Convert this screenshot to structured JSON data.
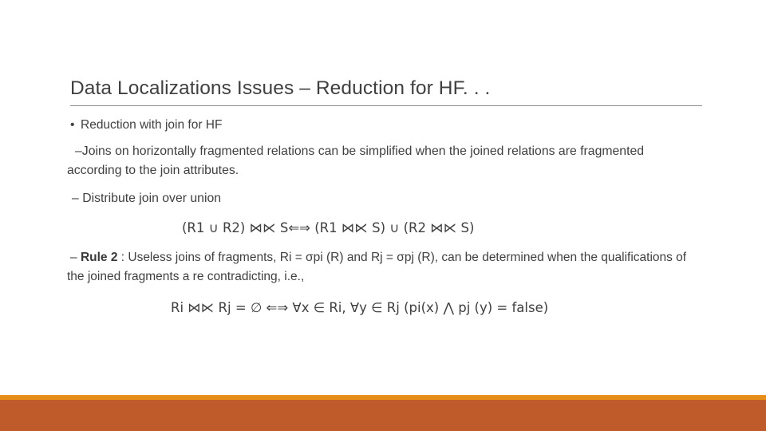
{
  "slide": {
    "title": "Data Localizations Issues – Reduction for HF. . .",
    "bullet1": {
      "marker": "•",
      "text": "Reduction with join for HF"
    },
    "para_joins": {
      "marker": "–",
      "text": "Joins on horizontally fragmented relations can be simplified when the joined relations are fragmented according to the join attributes."
    },
    "para_distribute": {
      "marker": "–",
      "text": "Distribute join over union"
    },
    "formula1": "(R1 ∪ R2) ⋈⋉ S⇐⇒ (R1 ⋈⋉ S) ∪ (R2 ⋈⋉ S)",
    "para_rule": {
      "marker": "–",
      "label": "Rule 2",
      "text": " : Useless joins of fragments, Ri = σpi (R) and Rj = σpj (R), can be determined when the qualifications of the joined fragments a re contradicting, i.e.,"
    },
    "formula2": "Ri ⋈⋉ Rj  = ∅ ⇐⇒ ∀x ∈ Ri, ∀y ∈ Rj (pi(x) ⋀ pj (y) = false)"
  },
  "colors": {
    "text": "#404040",
    "rule": "#8c8c8c",
    "accent_orange": "#e58f1a",
    "accent_terracotta": "#bf5b2b",
    "background": "#ffffff"
  }
}
